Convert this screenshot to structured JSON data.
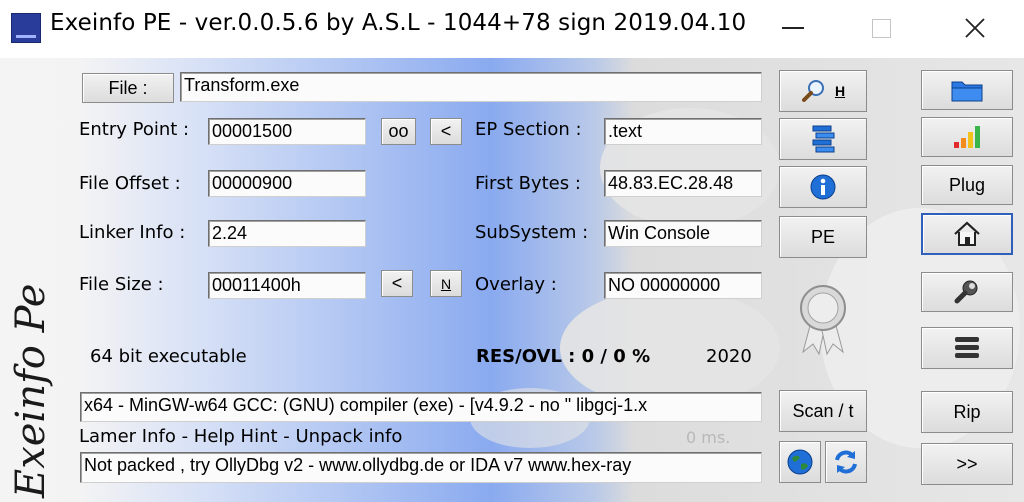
{
  "window": {
    "title": "Exeinfo PE - ver.0.0.5.6  by A.S.L -  1044+78 sign  2019.04.10"
  },
  "side_logo_text": "Exeinfo Pe",
  "file": {
    "button_label": "File :",
    "path": "Transform.exe"
  },
  "fields": {
    "entry_point_label": "Entry Point :",
    "entry_point": "00001500",
    "oo_label": "oo",
    "lt_label": "<",
    "ep_section_label": "EP Section :",
    "ep_section": ".text",
    "file_offset_label": "File Offset :",
    "file_offset": "00000900",
    "first_bytes_label": "First Bytes :",
    "first_bytes": "48.83.EC.28.48",
    "linker_info_label": "Linker Info :",
    "linker_info": "2.24",
    "subsystem_label": "SubSystem :",
    "subsystem": "Win Console",
    "file_size_label": "File Size :",
    "file_size": "00011400h",
    "size_lt_label": "<",
    "size_n_label": "N",
    "overlay_label": "Overlay :",
    "overlay": "NO   00000000"
  },
  "status": {
    "bitness": "64 bit executable",
    "res_ovl": "RES/OVL : 0 / 0 %",
    "year": "2020",
    "detection": "x64 - MinGW-w64 GCC: (GNU) compiler (exe) - [v4.9.2 - no \" libgcj-1.x",
    "hint_links": "Lamer Info - Help Hint - Unpack info",
    "timing": "0 ms.",
    "unpack_info": "Not packed , try OllyDbg v2 - www.ollydbg.de or IDA v7 www.hex-ray"
  },
  "middle_buttons": {
    "search_h": "H",
    "pe": "PE",
    "scan": "Scan / t"
  },
  "right_buttons": {
    "plug": "Plug",
    "rip": "Rip",
    "more": ">>"
  },
  "colors": {
    "accent_blue": "#2f5fb8",
    "gradient_blue": "#8aaaf0",
    "icon_blue": "#1f6fd6"
  }
}
